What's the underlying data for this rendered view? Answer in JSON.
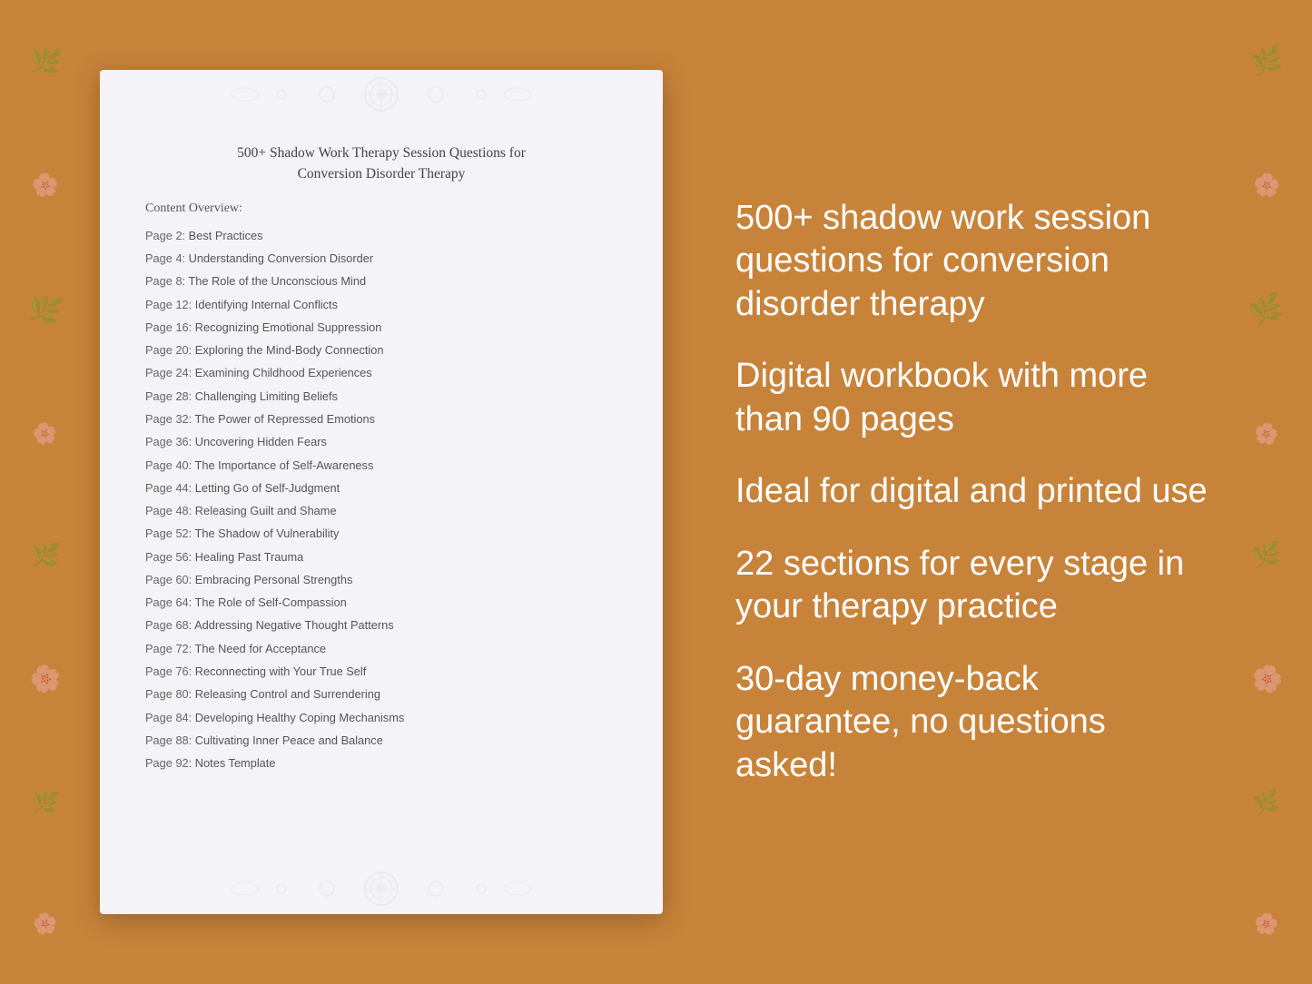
{
  "background_color": "#C8833A",
  "document": {
    "title_line1": "500+ Shadow Work Therapy Session Questions for",
    "title_line2": "Conversion Disorder Therapy",
    "content_overview_label": "Content Overview:",
    "toc": [
      {
        "page": "Page  2:",
        "title": "Best Practices"
      },
      {
        "page": "Page  4:",
        "title": "Understanding Conversion Disorder"
      },
      {
        "page": "Page  8:",
        "title": "The Role of the Unconscious Mind"
      },
      {
        "page": "Page 12:",
        "title": "Identifying Internal Conflicts"
      },
      {
        "page": "Page 16:",
        "title": "Recognizing Emotional Suppression"
      },
      {
        "page": "Page 20:",
        "title": "Exploring the Mind-Body Connection"
      },
      {
        "page": "Page 24:",
        "title": "Examining Childhood Experiences"
      },
      {
        "page": "Page 28:",
        "title": "Challenging Limiting Beliefs"
      },
      {
        "page": "Page 32:",
        "title": "The Power of Repressed Emotions"
      },
      {
        "page": "Page 36:",
        "title": "Uncovering Hidden Fears"
      },
      {
        "page": "Page 40:",
        "title": "The Importance of Self-Awareness"
      },
      {
        "page": "Page 44:",
        "title": "Letting Go of Self-Judgment"
      },
      {
        "page": "Page 48:",
        "title": "Releasing Guilt and Shame"
      },
      {
        "page": "Page 52:",
        "title": "The Shadow of Vulnerability"
      },
      {
        "page": "Page 56:",
        "title": "Healing Past Trauma"
      },
      {
        "page": "Page 60:",
        "title": "Embracing Personal Strengths"
      },
      {
        "page": "Page 64:",
        "title": "The Role of Self-Compassion"
      },
      {
        "page": "Page 68:",
        "title": "Addressing Negative Thought Patterns"
      },
      {
        "page": "Page 72:",
        "title": "The Need for Acceptance"
      },
      {
        "page": "Page 76:",
        "title": "Reconnecting with Your True Self"
      },
      {
        "page": "Page 80:",
        "title": "Releasing Control and Surrendering"
      },
      {
        "page": "Page 84:",
        "title": "Developing Healthy Coping Mechanisms"
      },
      {
        "page": "Page 88:",
        "title": "Cultivating Inner Peace and Balance"
      },
      {
        "page": "Page 92:",
        "title": "Notes Template"
      }
    ]
  },
  "features": [
    "500+ shadow work session questions for conversion disorder therapy",
    "Digital workbook with more than 90 pages",
    "Ideal for digital and printed use",
    "22 sections for every stage in your therapy practice",
    "30-day money-back guarantee, no questions asked!"
  ]
}
